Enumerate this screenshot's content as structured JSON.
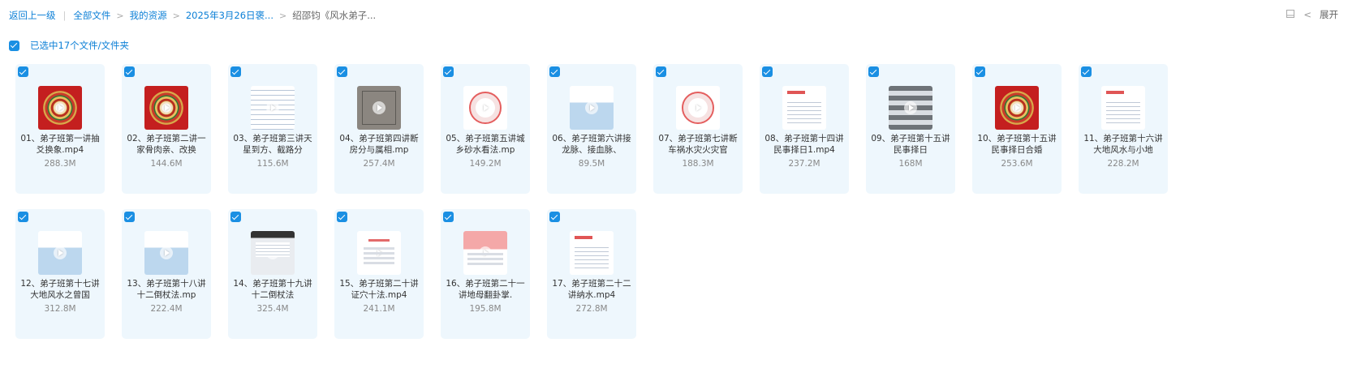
{
  "breadcrumb": {
    "back": "返回上一级",
    "items": [
      "全部文件",
      "我的资源",
      "2025年3月26日褒...",
      "绍邵钧《风水弟子..."
    ]
  },
  "toolbar": {
    "expand_label": "展开"
  },
  "selection": {
    "label": "已选中17个文件/文件夹",
    "checked": true
  },
  "files": [
    {
      "name": "01、弟子班第一讲抽爻换象.mp4",
      "size": "288.3M",
      "thumb": "luopan",
      "selected": true
    },
    {
      "name": "02、弟子班第二讲一家骨肉亲、改换",
      "size": "144.6M",
      "thumb": "luopan",
      "selected": true
    },
    {
      "name": "03、弟子班第三讲天星到方、截路分",
      "size": "115.6M",
      "thumb": "doc",
      "selected": true
    },
    {
      "name": "04、弟子班第四讲断房分与属相.mp",
      "size": "257.4M",
      "thumb": "sketch",
      "selected": true
    },
    {
      "name": "05、弟子班第五讲城乡砂水看法.mp",
      "size": "149.2M",
      "thumb": "chart",
      "selected": true
    },
    {
      "name": "06、弟子班第六讲接龙脉、接血脉、",
      "size": "89.5M",
      "thumb": "doc-sky",
      "selected": true
    },
    {
      "name": "07、弟子班第七讲断车祸水灾火灾官",
      "size": "188.3M",
      "thumb": "chart",
      "selected": true
    },
    {
      "name": "08、弟子班第十四讲民事择日1.mp4",
      "size": "237.2M",
      "thumb": "redtext",
      "selected": true
    },
    {
      "name": "09、弟子班第十五讲民事择日",
      "size": "168M",
      "thumb": "table",
      "selected": true
    },
    {
      "name": "10、弟子班第十五讲民事择日合婚",
      "size": "253.6M",
      "thumb": "luopan",
      "selected": true
    },
    {
      "name": "11、弟子班第十六讲大地风水与小地",
      "size": "228.2M",
      "thumb": "redtext",
      "selected": true
    },
    {
      "name": "12、弟子班第十七讲大地风水之曾国",
      "size": "312.8M",
      "thumb": "doc-sky",
      "selected": true
    },
    {
      "name": "13、弟子班第十八讲十二倒杖法.mp",
      "size": "222.4M",
      "thumb": "doc-sky",
      "selected": true
    },
    {
      "name": "14、弟子班第十九讲十二倒杖法",
      "size": "325.4M",
      "thumb": "screen",
      "selected": true
    },
    {
      "name": "15、弟子班第二十讲证穴十法.mp4",
      "size": "241.1M",
      "thumb": "title",
      "selected": true
    },
    {
      "name": "16、弟子班第二十一讲地母翻卦掌.",
      "size": "195.8M",
      "thumb": "banner",
      "selected": true
    },
    {
      "name": "17、弟子班第二十二讲纳水.mp4",
      "size": "272.8M",
      "thumb": "redtext",
      "selected": true
    }
  ]
}
